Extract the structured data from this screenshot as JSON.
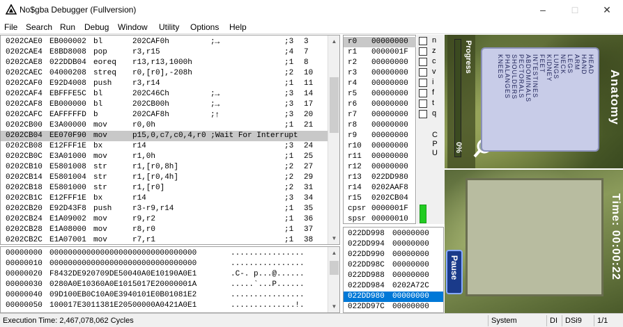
{
  "window": {
    "title": "No$gba Debugger (Fullversion)"
  },
  "menu": [
    "File",
    "Search",
    "Run",
    "Debug",
    "Window",
    "Utility",
    "Options",
    "Help"
  ],
  "disasm": [
    {
      "addr": "0202CAE0",
      "code": "EB000002",
      "op": "bl",
      "args": "202CAF0h",
      "note": ";",
      "cyc": ";3",
      "c2": "3"
    },
    {
      "addr": "0202CAE4",
      "code": "E8BD8008",
      "op": "pop",
      "args": "r3,r15",
      "note": "",
      "cyc": ";4",
      "c2": "7"
    },
    {
      "addr": "0202CAE8",
      "code": "022DDB04",
      "op": "eoreq",
      "args": "r13,r13,1000h",
      "note": "",
      "cyc": ";1",
      "c2": "8"
    },
    {
      "addr": "0202CAEC",
      "code": "04000208",
      "op": "streq",
      "args": "r0,[r0],-208h",
      "note": "",
      "cyc": ";2",
      "c2": "10"
    },
    {
      "addr": "0202CAF0",
      "code": "E92D4008",
      "op": "push",
      "args": "r3,r14",
      "note": "",
      "cyc": ";1",
      "c2": "11"
    },
    {
      "addr": "0202CAF4",
      "code": "EBFFFE5C",
      "op": "bl",
      "args": "202C46Ch",
      "note": ";",
      "cyc": ";3",
      "c2": "14"
    },
    {
      "addr": "0202CAF8",
      "code": "EB000000",
      "op": "bl",
      "args": "202CB00h",
      "note": ";",
      "cyc": ";3",
      "c2": "17"
    },
    {
      "addr": "0202CAFC",
      "code": "EAFFFFFD",
      "op": "b",
      "args": "202CAF8h",
      "note": ";",
      "cyc": ";3",
      "c2": "20"
    },
    {
      "addr": "0202CB00",
      "code": "E3A00000",
      "op": "mov",
      "args": "r0,0h",
      "note": "",
      "cyc": ";1",
      "c2": "21"
    },
    {
      "addr": "0202CB04",
      "code": "EE070F90",
      "op": "mov",
      "args": "p15,0,c7,c0,4,r0 ;Wait For Interrupt",
      "note": "",
      "cyc": "",
      "c2": ""
    },
    {
      "addr": "0202CB08",
      "code": "E12FFF1E",
      "op": "bx",
      "args": "r14",
      "note": "",
      "cyc": ";3",
      "c2": "24"
    },
    {
      "addr": "0202CB0C",
      "code": "E3A01000",
      "op": "mov",
      "args": "r1,0h",
      "note": "",
      "cyc": ";1",
      "c2": "25"
    },
    {
      "addr": "0202CB10",
      "code": "E5801008",
      "op": "str",
      "args": "r1,[r0,8h]",
      "note": "",
      "cyc": ";2",
      "c2": "27"
    },
    {
      "addr": "0202CB14",
      "code": "E5801004",
      "op": "str",
      "args": "r1,[r0,4h]",
      "note": "",
      "cyc": ";2",
      "c2": "29"
    },
    {
      "addr": "0202CB18",
      "code": "E5801000",
      "op": "str",
      "args": "r1,[r0]",
      "note": "",
      "cyc": ";2",
      "c2": "31"
    },
    {
      "addr": "0202CB1C",
      "code": "E12FFF1E",
      "op": "bx",
      "args": "r14",
      "note": "",
      "cyc": ";3",
      "c2": "34"
    },
    {
      "addr": "0202CB20",
      "code": "E92D43F8",
      "op": "push",
      "args": "r3-r9,r14",
      "note": "",
      "cyc": ";1",
      "c2": "35"
    },
    {
      "addr": "0202CB24",
      "code": "E1A09002",
      "op": "mov",
      "args": "r9,r2",
      "note": "",
      "cyc": ";1",
      "c2": "36"
    },
    {
      "addr": "0202CB28",
      "code": "E1A08000",
      "op": "mov",
      "args": "r8,r0",
      "note": "",
      "cyc": ";1",
      "c2": "37"
    },
    {
      "addr": "0202CB2C",
      "code": "E1A07001",
      "op": "mov",
      "args": "r7,r1",
      "note": "",
      "cyc": ";1",
      "c2": "38"
    }
  ],
  "hex": [
    {
      "addr": "00000000",
      "bytes": "00000000000000000000000000000000",
      "ascii": "................"
    },
    {
      "addr": "00000010",
      "bytes": "00000000000000000000000000000000",
      "ascii": "................"
    },
    {
      "addr": "00000020",
      "bytes": "F8432DE920709DE50040A0E10190A0E1",
      "ascii": ".C-. p...@......"
    },
    {
      "addr": "00000030",
      "bytes": "0280A0E10360A0E1015017E20000001A",
      "ascii": ".....`...P......"
    },
    {
      "addr": "00000040",
      "bytes": "09D100EB0C10A0E3940101E0B01081E2",
      "ascii": "................"
    },
    {
      "addr": "00000050",
      "bytes": "100017E3011381E20500000A0421A0E1",
      "ascii": "..............!."
    }
  ],
  "registers": [
    {
      "name": "r0",
      "value": "00000000"
    },
    {
      "name": "r1",
      "value": "0000001F"
    },
    {
      "name": "r2",
      "value": "00000000"
    },
    {
      "name": "r3",
      "value": "00000000"
    },
    {
      "name": "r4",
      "value": "00000000"
    },
    {
      "name": "r5",
      "value": "00000000"
    },
    {
      "name": "r6",
      "value": "00000000"
    },
    {
      "name": "r7",
      "value": "00000000"
    },
    {
      "name": "r8",
      "value": "00000000"
    },
    {
      "name": "r9",
      "value": "00000000"
    },
    {
      "name": "r10",
      "value": "00000000"
    },
    {
      "name": "r11",
      "value": "00000000"
    },
    {
      "name": "r12",
      "value": "00000000"
    },
    {
      "name": "r13",
      "value": "022DD980"
    },
    {
      "name": "r14",
      "value": "0202AAF8"
    },
    {
      "name": "r15",
      "value": "0202CB04"
    },
    {
      "name": "cpsr",
      "value": "0000001F"
    },
    {
      "name": "spsr",
      "value": "00000010"
    }
  ],
  "flags": [
    "n",
    "z",
    "c",
    "v",
    "i",
    "f",
    "t",
    "q"
  ],
  "cpu_label": "CPU",
  "stack": [
    {
      "addr": "022DD998",
      "value": "00000000"
    },
    {
      "addr": "022DD994",
      "value": "00000000"
    },
    {
      "addr": "022DD990",
      "value": "00000000"
    },
    {
      "addr": "022DD98C",
      "value": "00000000"
    },
    {
      "addr": "022DD988",
      "value": "00000000"
    },
    {
      "addr": "022DD984",
      "value": "0202A72C"
    },
    {
      "addr": "022DD980",
      "value": "00000000"
    },
    {
      "addr": "022DD97C",
      "value": "00000000"
    }
  ],
  "game": {
    "progress_label": "Progress",
    "progress_value": "0%",
    "body_parts": [
      "HEAD",
      "HAND",
      "ARM",
      "LEGS",
      "NECK",
      "LUNGS",
      "KIDNEY",
      "FEET",
      "INTESTINES",
      "ABDOMINALS",
      "PECTORALS",
      "SHOULDERS",
      "PHALANGES",
      "KNEES"
    ],
    "anatomy_label": "Anatomy",
    "time_label": "Time: 00:00:22",
    "pause_label": "Pause"
  },
  "status": {
    "exec_time": "Execution Time: 2,467,078,062 Cycles",
    "mode": "System",
    "di": "DI",
    "dsi": "DSi9",
    "page": "1/1"
  }
}
